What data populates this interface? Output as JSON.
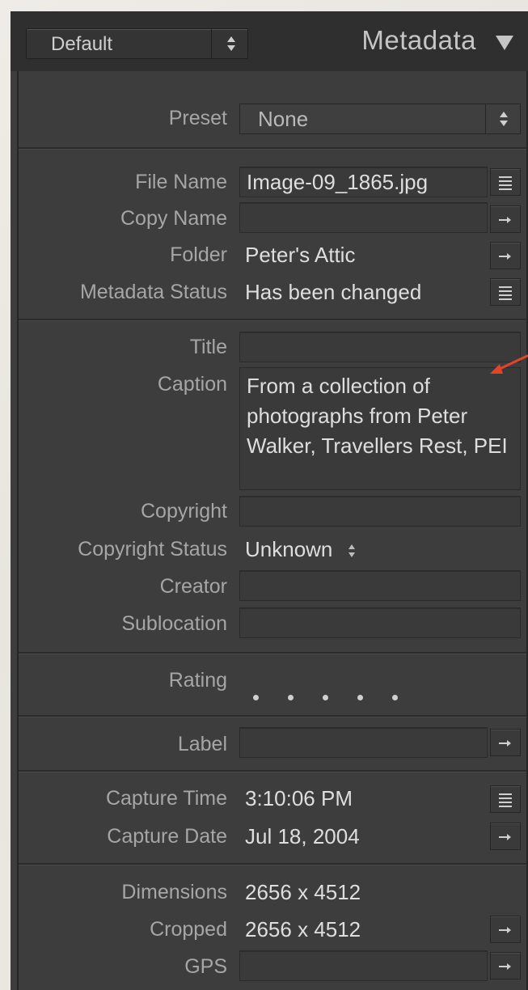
{
  "header": {
    "preset_menu": "Default",
    "title": "Metadata"
  },
  "preset_row": {
    "label": "Preset",
    "value": "None"
  },
  "file_section": {
    "file_name_label": "File Name",
    "file_name_value": "Image-09_1865.jpg",
    "copy_name_label": "Copy Name",
    "copy_name_value": "",
    "folder_label": "Folder",
    "folder_value": "Peter's Attic",
    "metadata_status_label": "Metadata Status",
    "metadata_status_value": "Has been changed"
  },
  "iptc_section": {
    "title_label": "Title",
    "title_value": "",
    "caption_label": "Caption",
    "caption_value": "From a collection of photographs from Peter Walker, Travellers Rest, PEI",
    "copyright_label": "Copyright",
    "copyright_value": "",
    "copyright_status_label": "Copyright Status",
    "copyright_status_value": "Unknown",
    "creator_label": "Creator",
    "creator_value": "",
    "sublocation_label": "Sublocation",
    "sublocation_value": ""
  },
  "rating_section": {
    "rating_label": "Rating",
    "rating_value": 0,
    "rating_max": 5
  },
  "label_section": {
    "label_label": "Label",
    "label_value": ""
  },
  "capture_section": {
    "capture_time_label": "Capture Time",
    "capture_time_value": "3:10:06 PM",
    "capture_date_label": "Capture Date",
    "capture_date_value": "Jul 18, 2004"
  },
  "dimension_section": {
    "dimensions_label": "Dimensions",
    "dimensions_value": "2656 x 4512",
    "cropped_label": "Cropped",
    "cropped_value": "2656 x 4512",
    "gps_label": "GPS",
    "gps_value": ""
  },
  "colors": {
    "panel_bg": "#3d3d3d",
    "header_bg": "#2f2f2f",
    "label_text": "#a6a6a6",
    "value_text": "#dedede",
    "annotation_arrow": "#e0442a"
  }
}
